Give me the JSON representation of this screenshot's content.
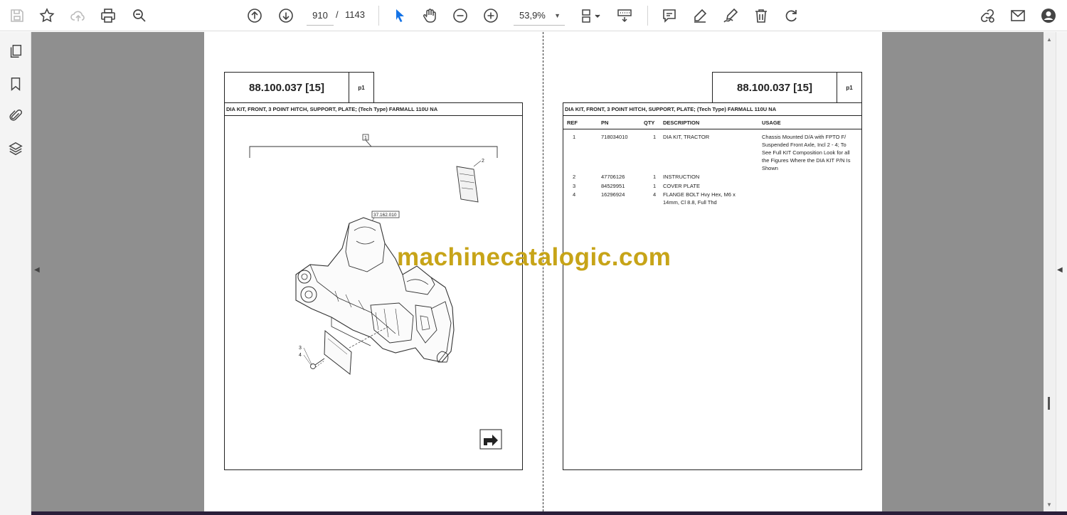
{
  "toolbar": {
    "page_current": "910",
    "page_separator": "/",
    "page_total": "1143",
    "zoom": "53,9%"
  },
  "document": {
    "part_code": "88.100.037 [15]",
    "page_label": "p1",
    "caption": "DIA KIT, FRONT, 3 POINT HITCH, SUPPORT, PLATE; (Tech Type) FARMALL 110U NA",
    "illustration": {
      "callout_top": "1",
      "callout_plate": "2",
      "callout_ref": "37.162.010",
      "callout_bolt_a": "3",
      "callout_bolt_b": "4"
    },
    "table": {
      "headers": {
        "ref": "REF",
        "pn": "PN",
        "qty": "QTY",
        "description": "DESCRIPTION",
        "usage": "USAGE"
      },
      "rows": [
        {
          "ref": "1",
          "pn": "718034010",
          "qty": "1",
          "description": "DIA KIT, TRACTOR",
          "usage": [
            "Chassis Mounted D/A with FPTO F/",
            "Suspended Front Axle, Incl 2 - 4; To",
            "See Full KIT Composition Look for all",
            "the Figures Where the DIA KIT P/N Is",
            "Shown"
          ]
        },
        {
          "ref": "2",
          "pn": "47706126",
          "qty": "1",
          "description": "INSTRUCTION",
          "usage": []
        },
        {
          "ref": "3",
          "pn": "84529951",
          "qty": "1",
          "description": "COVER PLATE",
          "usage": []
        },
        {
          "ref": "4",
          "pn": "16296924",
          "qty": "4",
          "description": [
            "FLANGE BOLT Hvy Hex, M6 x",
            "14mm, Cl 8.8, Full Thd"
          ],
          "usage": []
        }
      ]
    }
  },
  "watermark": "machinecatalogic.com",
  "colors": {
    "watermark": "#c7a418",
    "viewer_background": "#8f8f8f"
  },
  "icons": [
    "save-icon",
    "bookmark-star-icon",
    "upload-cloud-icon",
    "print-icon",
    "zoom-search-icon",
    "page-up-icon",
    "page-down-icon",
    "select-cursor-icon",
    "hand-tool-icon",
    "zoom-out-icon",
    "zoom-in-icon",
    "page-fit-icon",
    "scroll-mode-icon",
    "comment-icon",
    "highlight-pen-icon",
    "sign-icon",
    "delete-icon",
    "undo-icon",
    "link-share-icon",
    "mail-icon",
    "account-icon",
    "pages-thumbnail-icon",
    "bookmarks-icon",
    "attachments-icon",
    "layers-icon"
  ]
}
